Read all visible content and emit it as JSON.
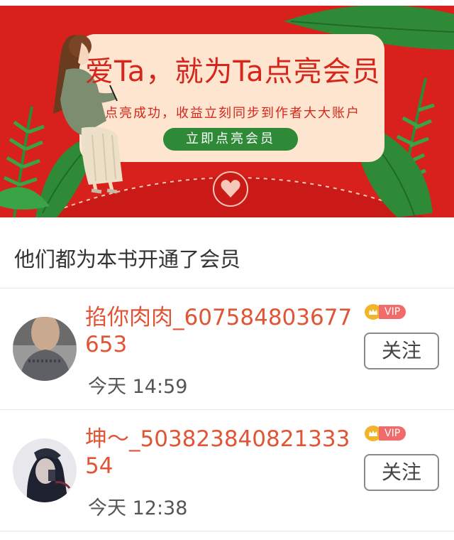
{
  "banner": {
    "title": "爱Ta，就为Ta点亮会员",
    "subtitle": "点亮成功，收益立刻同步到作者大大账户",
    "cta_label": "立即点亮会员"
  },
  "section": {
    "title": "他们都为本书开通了会员"
  },
  "members": [
    {
      "name": "掐你肉肉_607584803677653",
      "time": "今天 14:59",
      "badge": "VIP",
      "follow_label": "关注"
    },
    {
      "name": "坤～_50382384082133354",
      "time": "今天 12:38",
      "badge": "VIP",
      "follow_label": "关注"
    }
  ],
  "colors": {
    "banner_red": "#d8201d",
    "card_cream": "#fde5cf",
    "cta_green": "#2f8a37",
    "name_orange": "#e05536",
    "vip_gold": "#f0b52a",
    "vip_pink": "#f26b6b"
  }
}
